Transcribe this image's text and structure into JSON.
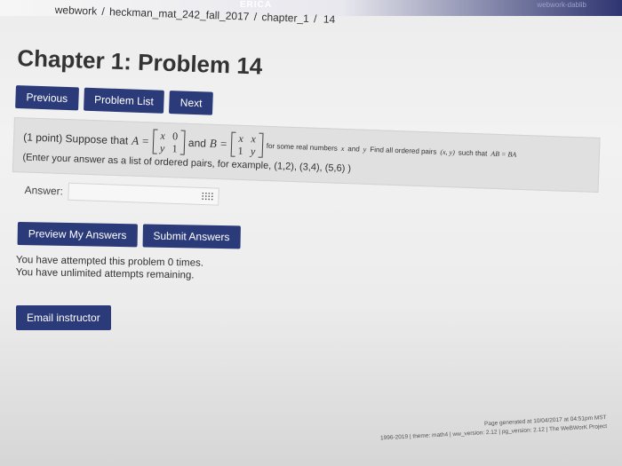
{
  "header": {
    "brand": "ERICA",
    "right_text": "webwork-dablib"
  },
  "breadcrumb": {
    "items": [
      "webwork",
      "heckman_mat_242_fall_2017",
      "chapter_1",
      "14"
    ],
    "separator": "/"
  },
  "page_title": "Chapter 1: Problem 14",
  "nav": {
    "previous_label": "Previous",
    "problem_list_label": "Problem List",
    "next_label": "Next"
  },
  "problem": {
    "points": "(1 point) Suppose that",
    "a_var": "A =",
    "matrix_a": [
      "x",
      "0",
      "y",
      "1"
    ],
    "and_b": "and",
    "b_var": "B =",
    "matrix_b": [
      "x",
      "x",
      "1",
      "y"
    ],
    "condition": "for some real numbers",
    "var_x": "x",
    "and_word": "and",
    "var_y": "y",
    "find_text": "Find all ordered pairs",
    "pair": "(x, y)",
    "such_that": "such that",
    "equation": "AB = BA",
    "instructions": "(Enter your answer as a list of ordered pairs, for example, (1,2), (3,4), (5,6) )"
  },
  "answer": {
    "label": "Answer:",
    "value": "",
    "placeholder": ""
  },
  "buttons": {
    "preview_label": "Preview My Answers",
    "submit_label": "Submit Answers",
    "email_label": "Email instructor"
  },
  "status": {
    "attempted": "You have attempted this problem 0 times.",
    "remaining": "You have unlimited attempts remaining."
  },
  "footer": {
    "generated": "Page generated at 10/04/2017 at 04:51pm MST",
    "theme": "1996-2019 | theme: math4 | ww_version: 2.12 | pg_version: 2.12 | The WeBWorK Project"
  },
  "colors": {
    "button_bg": "#2b3a78",
    "problem_box_bg": "#e0e0e0"
  }
}
